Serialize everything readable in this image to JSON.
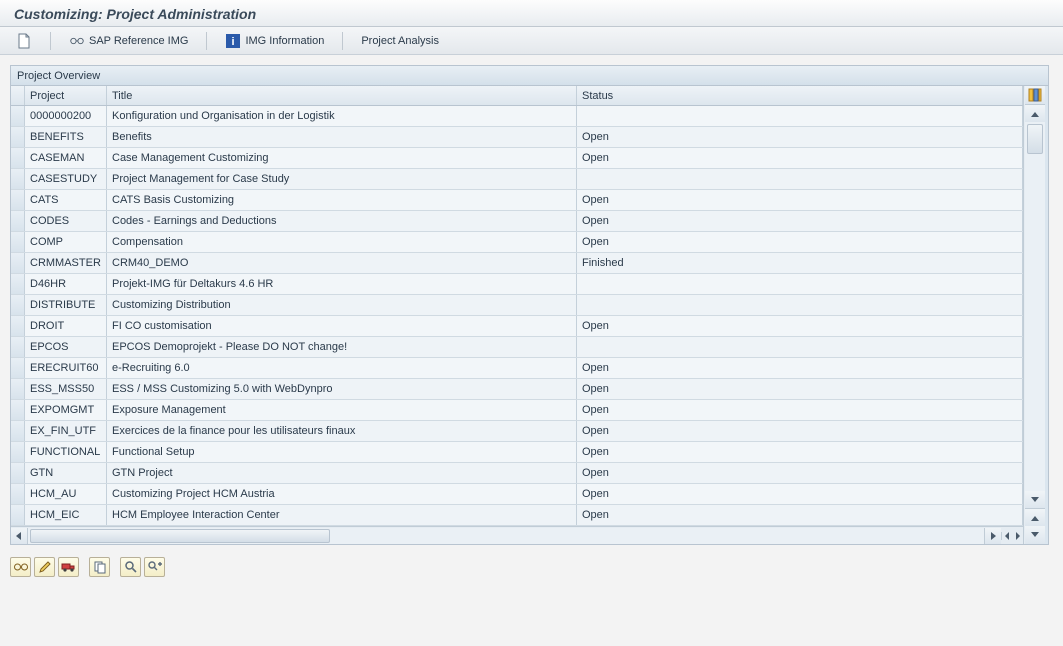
{
  "header": {
    "title": "Customizing: Project Administration"
  },
  "toolbar": {
    "sap_ref_img": "SAP Reference IMG",
    "img_info": "IMG Information",
    "project_analysis": "Project Analysis"
  },
  "panel": {
    "title": "Project Overview"
  },
  "columns": {
    "project": "Project",
    "title": "Title",
    "status": "Status"
  },
  "rows": [
    {
      "project": "0000000200",
      "title": "Konfiguration und Organisation in der Logistik",
      "status": ""
    },
    {
      "project": "BENEFITS",
      "title": "Benefits",
      "status": "Open"
    },
    {
      "project": "CASEMAN",
      "title": "Case Management Customizing",
      "status": "Open"
    },
    {
      "project": "CASESTUDY",
      "title": "Project Management for Case Study",
      "status": ""
    },
    {
      "project": "CATS",
      "title": "CATS Basis Customizing",
      "status": "Open"
    },
    {
      "project": "CODES",
      "title": "Codes - Earnings and Deductions",
      "status": "Open"
    },
    {
      "project": "COMP",
      "title": "Compensation",
      "status": "Open"
    },
    {
      "project": "CRMMASTER",
      "title": "CRM40_DEMO",
      "status": "Finished"
    },
    {
      "project": "D46HR",
      "title": "Projekt-IMG für Deltakurs 4.6 HR",
      "status": ""
    },
    {
      "project": "DISTRIBUTE",
      "title": "Customizing Distribution",
      "status": ""
    },
    {
      "project": "DROIT",
      "title": "FI CO customisation",
      "status": "Open"
    },
    {
      "project": "EPCOS",
      "title": "EPCOS Demoprojekt - Please DO NOT change!",
      "status": ""
    },
    {
      "project": "ERECRUIT60",
      "title": "e-Recruiting 6.0",
      "status": "Open"
    },
    {
      "project": "ESS_MSS50",
      "title": "ESS / MSS Customizing 5.0 with WebDynpro",
      "status": "Open"
    },
    {
      "project": "EXPOMGMT",
      "title": "Exposure Management",
      "status": "Open"
    },
    {
      "project": "EX_FIN_UTF",
      "title": "Exercices de la finance pour les utilisateurs finaux",
      "status": "Open"
    },
    {
      "project": "FUNCTIONAL",
      "title": "Functional Setup",
      "status": "Open"
    },
    {
      "project": "GTN",
      "title": "GTN Project",
      "status": "Open"
    },
    {
      "project": "HCM_AU",
      "title": "Customizing Project HCM Austria",
      "status": "Open"
    },
    {
      "project": "HCM_EIC",
      "title": "HCM Employee Interaction Center",
      "status": "Open"
    }
  ],
  "icons": {
    "new": "new-document-icon",
    "glasses": "glasses-icon",
    "info": "info-icon",
    "config": "column-config-icon",
    "display": "display-icon",
    "edit": "pencil-icon",
    "transport": "truck-icon",
    "copy": "copy-icon",
    "find": "find-icon",
    "find_next": "find-next-icon"
  }
}
